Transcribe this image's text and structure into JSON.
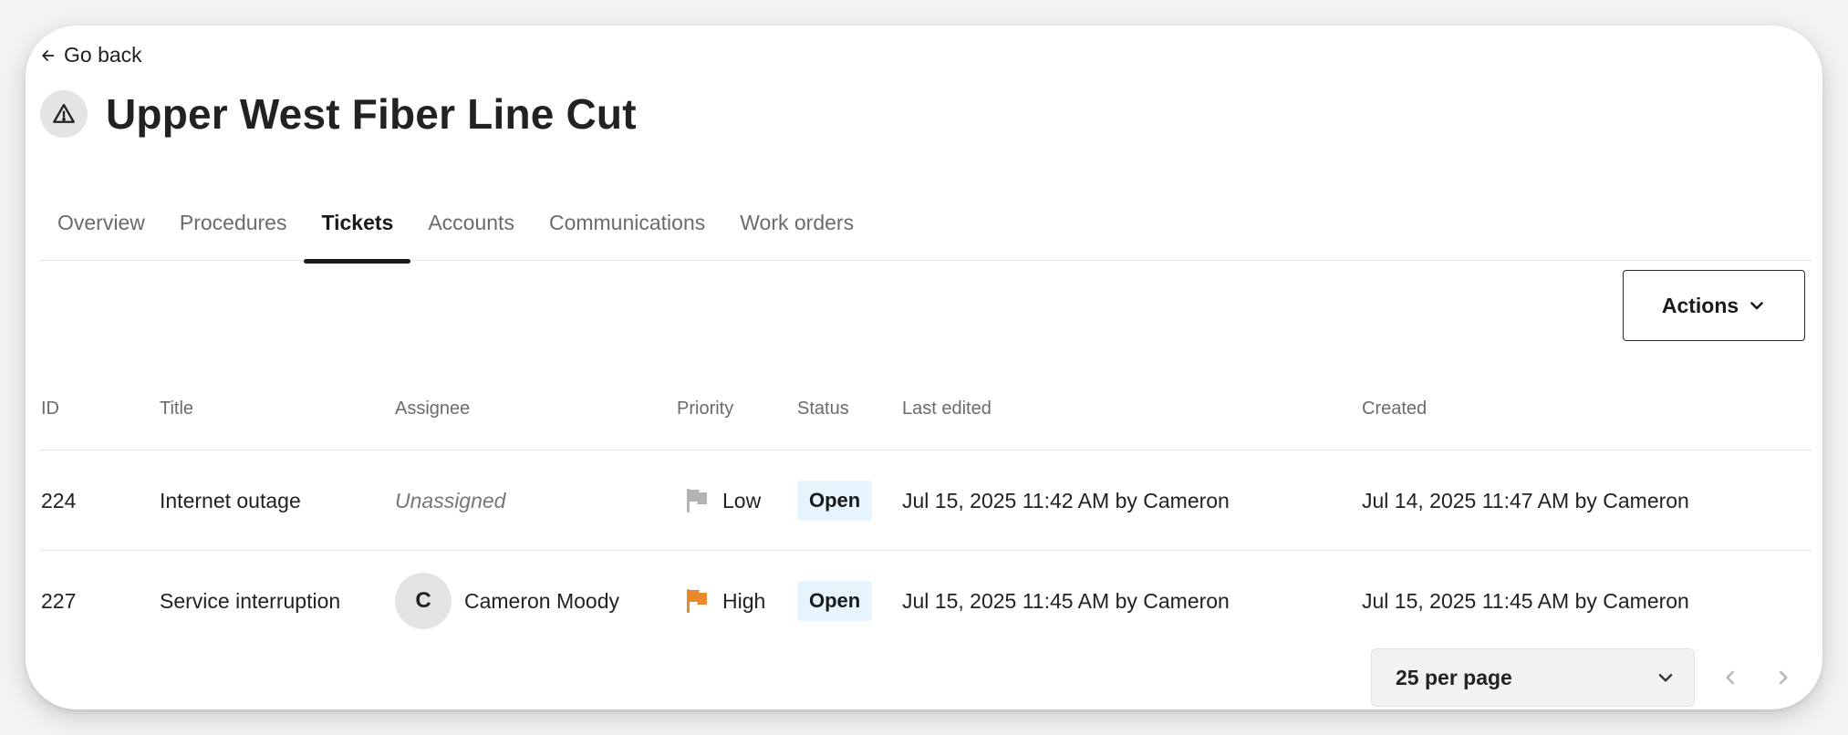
{
  "nav": {
    "back_label": "Go back"
  },
  "page": {
    "title": "Upper West Fiber Line Cut",
    "icon": "alert-triangle-icon"
  },
  "tabs": [
    {
      "label": "Overview",
      "active": false
    },
    {
      "label": "Procedures",
      "active": false
    },
    {
      "label": "Tickets",
      "active": true
    },
    {
      "label": "Accounts",
      "active": false
    },
    {
      "label": "Communications",
      "active": false
    },
    {
      "label": "Work orders",
      "active": false
    }
  ],
  "toolbar": {
    "actions_label": "Actions"
  },
  "table": {
    "columns": {
      "id": "ID",
      "title": "Title",
      "assignee": "Assignee",
      "priority": "Priority",
      "status": "Status",
      "last_edited": "Last edited",
      "created": "Created"
    },
    "rows": [
      {
        "id": "224",
        "title": "Internet outage",
        "assignee": "Unassigned",
        "assignee_initial": "",
        "priority": "Low",
        "priority_color": "#b3b3b3",
        "status": "Open",
        "last_edited": "Jul 15, 2025 11:42 AM by Cameron",
        "created": "Jul 14, 2025 11:47 AM by Cameron"
      },
      {
        "id": "227",
        "title": "Service interruption",
        "assignee": "Cameron Moody",
        "assignee_initial": "C",
        "priority": "High",
        "priority_color": "#e8892b",
        "status": "Open",
        "last_edited": "Jul 15, 2025 11:45 AM by Cameron",
        "created": "Jul 15, 2025 11:45 AM by Cameron"
      }
    ]
  },
  "pagination": {
    "per_page_label": "25 per page"
  },
  "colors": {
    "status_badge_bg": "#e6f4fd",
    "accent": "#1a1a1a"
  }
}
